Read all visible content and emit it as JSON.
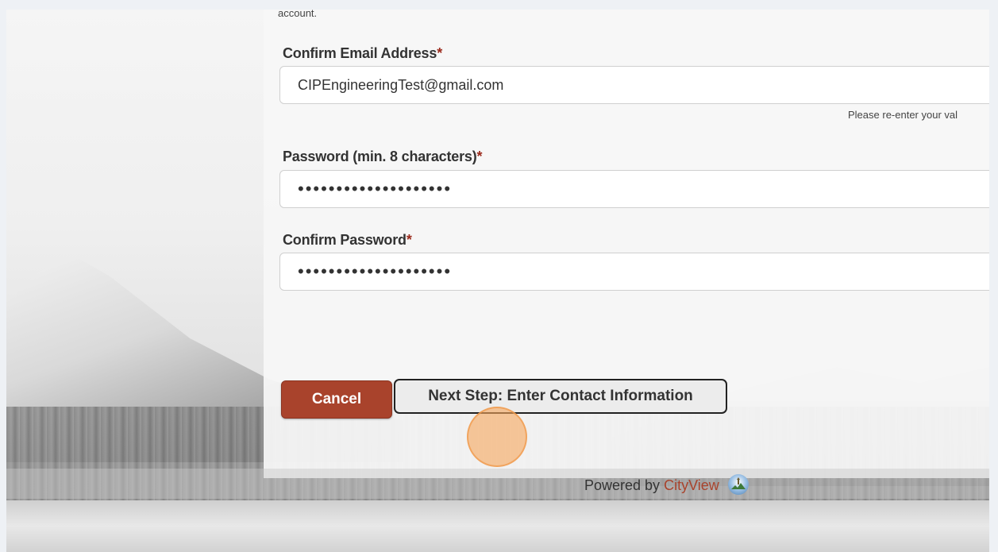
{
  "form": {
    "account_text": "account.",
    "required_marker": "*",
    "confirm_email": {
      "label": "Confirm Email Address",
      "value": "CIPEngineeringTest@gmail.com",
      "hint": "Please re-enter your val"
    },
    "password": {
      "label": "Password (min. 8 characters)",
      "value": "••••••••••••••••••••"
    },
    "confirm_password": {
      "label": "Confirm Password",
      "value": "••••••••••••••••••••"
    }
  },
  "actions": {
    "cancel_label": "Cancel",
    "next_label": "Next Step: Enter Contact Information"
  },
  "footer": {
    "powered_by": "Powered by",
    "brand": "CityView",
    "brand_icon": "cityview-logo-icon"
  },
  "colors": {
    "accent": "#a9432c",
    "required": "#9b2a1c",
    "click_indicator": "#f6a65c"
  }
}
